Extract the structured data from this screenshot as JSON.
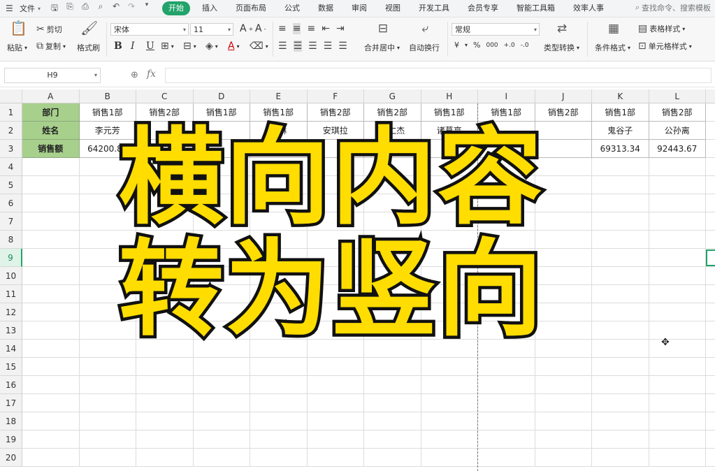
{
  "menubar": {
    "file_label": "文件",
    "tabs": [
      "开始",
      "插入",
      "页面布局",
      "公式",
      "数据",
      "审阅",
      "视图",
      "开发工具",
      "会员专享",
      "智能工具箱",
      "效率人事"
    ],
    "active_tab": "开始",
    "search_placeholder": "查找命令、搜索模板"
  },
  "ribbon": {
    "paste": "粘贴",
    "cut": "剪切",
    "copy": "复制",
    "format_painter": "格式刷",
    "font_name": "宋体",
    "font_size": "11",
    "bold": "B",
    "italic": "I",
    "underline": "U",
    "merge_center": "合并居中",
    "auto_wrap": "自动换行",
    "number_format": "常规",
    "type_convert": "类型转换",
    "conditional_format": "条件格式",
    "table_style": "表格样式",
    "cell_style": "单元格样式",
    "currency": "¥",
    "percent": "%",
    "thousands": "000",
    "inc_decimal": "+.0",
    "dec_decimal": "-.0"
  },
  "formula_bar": {
    "name_box": "H9",
    "fx": "fx",
    "formula": ""
  },
  "sheet": {
    "columns": [
      "A",
      "B",
      "C",
      "D",
      "E",
      "F",
      "G",
      "H",
      "I",
      "J",
      "K",
      "L"
    ],
    "rows": [
      "1",
      "2",
      "3",
      "4",
      "5",
      "6",
      "7",
      "8",
      "9",
      "10",
      "11",
      "12",
      "13",
      "14",
      "15",
      "16",
      "17",
      "18",
      "19",
      "20"
    ],
    "active_row": "9",
    "cells": {
      "row1": [
        "部门",
        "销售1部",
        "销售2部",
        "销售1部",
        "销售1部",
        "销售2部",
        "销售2部",
        "销售1部",
        "销售1部",
        "销售2部",
        "销售1部",
        "销售2部"
      ],
      "row2": [
        "姓名",
        "李元芳",
        "",
        "",
        "艾琳",
        "安琪拉",
        "狄仁杰",
        "诸葛亮",
        "",
        "",
        "鬼谷子",
        "公孙离"
      ],
      "row3": [
        "销售额",
        "64200.82",
        "",
        "",
        "",
        "",
        "",
        "",
        "",
        "",
        "69313.34",
        "92443.67"
      ]
    }
  },
  "overlay": {
    "line1": "横向内容",
    "line2": "转为竖向",
    "fill_color": "#ffdd00",
    "stroke_color": "#111111"
  },
  "colors": {
    "accent": "#21a36a",
    "header_fill": "#a8d08d"
  }
}
